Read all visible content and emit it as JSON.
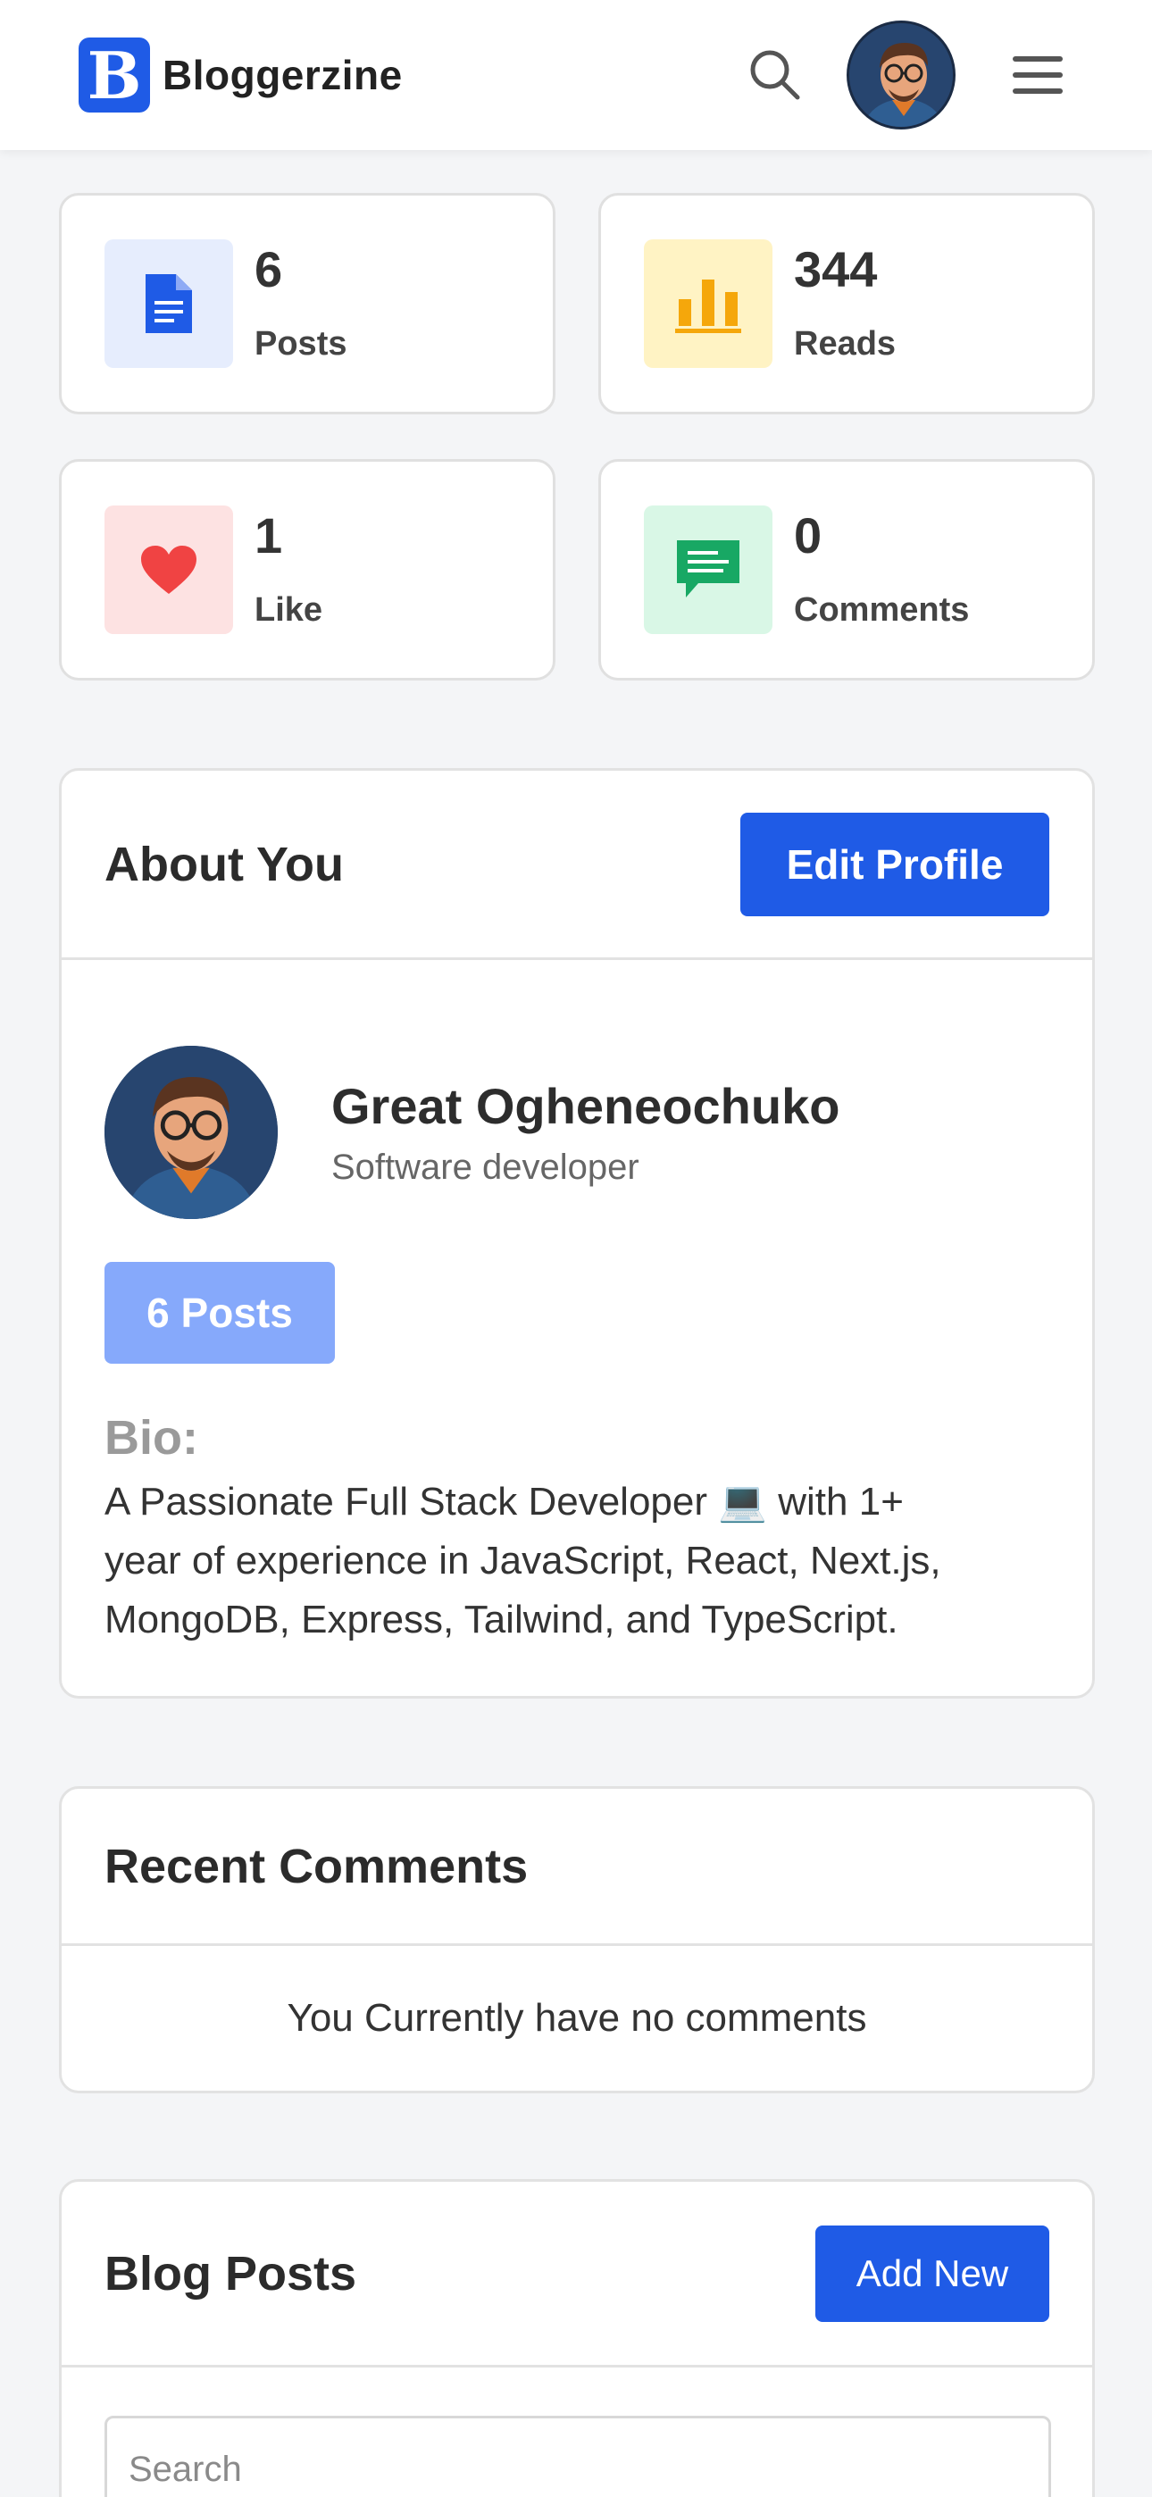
{
  "header": {
    "logo_letter": "B",
    "brand": "Bloggerzine",
    "search_icon": "search-icon",
    "menu_icon": "hamburger-menu-icon",
    "accent_color": "#1f5be6"
  },
  "stats": [
    {
      "value": "6",
      "label": "Posts",
      "icon": "document-icon",
      "icon_bg": "#e6edfd",
      "icon_color": "#1f5be6"
    },
    {
      "value": "344",
      "label": "Reads",
      "icon": "bar-chart-icon",
      "icon_bg": "#fff3c4",
      "icon_color": "#f5a70b"
    },
    {
      "value": "1",
      "label": "Like",
      "icon": "heart-icon",
      "icon_bg": "#fde2e2",
      "icon_color": "#f04343"
    },
    {
      "value": "0",
      "label": "Comments",
      "icon": "comment-icon",
      "icon_bg": "#d9f7e6",
      "icon_color": "#18a864"
    }
  ],
  "about": {
    "title": "About You",
    "edit_button": "Edit Profile",
    "name": "Great Ogheneochuko",
    "role": "Software developer",
    "posts_badge": "6 Posts",
    "bio_label": "Bio:",
    "bio_lines": [
      "A Passionate Full Stack Developer 💻 with 1+",
      "year of experience in JavaScript, React, Next.js,",
      "MongoDB, Express, Tailwind, and TypeScript."
    ]
  },
  "recent_comments": {
    "title": "Recent Comments",
    "empty_message": "You Currently have no comments"
  },
  "blog_posts": {
    "title": "Blog Posts",
    "add_button": "Add New",
    "search_placeholder": "Search"
  }
}
